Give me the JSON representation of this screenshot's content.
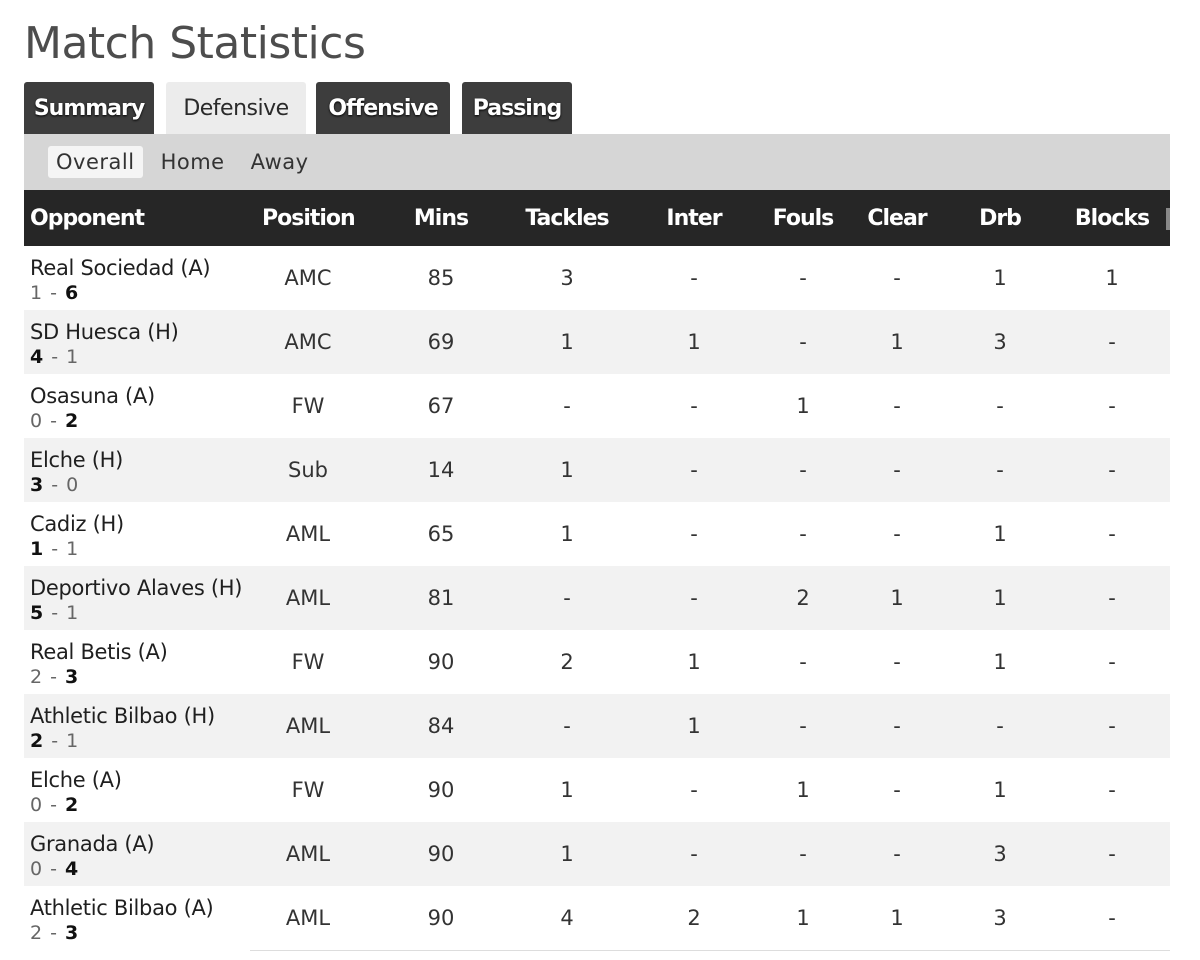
{
  "page": {
    "title": "Match Statistics"
  },
  "tabs": [
    {
      "label": "Summary",
      "active": false
    },
    {
      "label": "Defensive",
      "active": true
    },
    {
      "label": "Offensive",
      "active": false
    },
    {
      "label": "Passing",
      "active": false
    }
  ],
  "subtabs": [
    {
      "label": "Overall",
      "active": true
    },
    {
      "label": "Home",
      "active": false
    },
    {
      "label": "Away",
      "active": false
    }
  ],
  "table": {
    "headers": [
      "Opponent",
      "Position",
      "Mins",
      "Tackles",
      "Inter",
      "Fouls",
      "Clear",
      "Drb",
      "Blocks"
    ],
    "rows": [
      {
        "opponent": "Real Sociedad (A)",
        "score_home": "1",
        "score_away": "6",
        "bold": "away",
        "position": "AMC",
        "mins": "85",
        "tackles": "3",
        "inter": "-",
        "fouls": "-",
        "clear": "-",
        "drb": "1",
        "blocks": "1"
      },
      {
        "opponent": "SD Huesca (H)",
        "score_home": "4",
        "score_away": "1",
        "bold": "home",
        "position": "AMC",
        "mins": "69",
        "tackles": "1",
        "inter": "1",
        "fouls": "-",
        "clear": "1",
        "drb": "3",
        "blocks": "-"
      },
      {
        "opponent": "Osasuna (A)",
        "score_home": "0",
        "score_away": "2",
        "bold": "away",
        "position": "FW",
        "mins": "67",
        "tackles": "-",
        "inter": "-",
        "fouls": "1",
        "clear": "-",
        "drb": "-",
        "blocks": "-"
      },
      {
        "opponent": "Elche (H)",
        "score_home": "3",
        "score_away": "0",
        "bold": "home",
        "position": "Sub",
        "mins": "14",
        "tackles": "1",
        "inter": "-",
        "fouls": "-",
        "clear": "-",
        "drb": "-",
        "blocks": "-"
      },
      {
        "opponent": "Cadiz (H)",
        "score_home": "1",
        "score_away": "1",
        "bold": "home",
        "position": "AML",
        "mins": "65",
        "tackles": "1",
        "inter": "-",
        "fouls": "-",
        "clear": "-",
        "drb": "1",
        "blocks": "-"
      },
      {
        "opponent": "Deportivo Alaves (H)",
        "score_home": "5",
        "score_away": "1",
        "bold": "home",
        "position": "AML",
        "mins": "81",
        "tackles": "-",
        "inter": "-",
        "fouls": "2",
        "clear": "1",
        "drb": "1",
        "blocks": "-"
      },
      {
        "opponent": "Real Betis (A)",
        "score_home": "2",
        "score_away": "3",
        "bold": "away",
        "position": "FW",
        "mins": "90",
        "tackles": "2",
        "inter": "1",
        "fouls": "-",
        "clear": "-",
        "drb": "1",
        "blocks": "-"
      },
      {
        "opponent": "Athletic Bilbao (H)",
        "score_home": "2",
        "score_away": "1",
        "bold": "home",
        "position": "AML",
        "mins": "84",
        "tackles": "-",
        "inter": "1",
        "fouls": "-",
        "clear": "-",
        "drb": "-",
        "blocks": "-"
      },
      {
        "opponent": "Elche (A)",
        "score_home": "0",
        "score_away": "2",
        "bold": "away",
        "position": "FW",
        "mins": "90",
        "tackles": "1",
        "inter": "-",
        "fouls": "1",
        "clear": "-",
        "drb": "1",
        "blocks": "-"
      },
      {
        "opponent": "Granada (A)",
        "score_home": "0",
        "score_away": "4",
        "bold": "away",
        "position": "AML",
        "mins": "90",
        "tackles": "1",
        "inter": "-",
        "fouls": "-",
        "clear": "-",
        "drb": "3",
        "blocks": "-"
      },
      {
        "opponent": "Athletic Bilbao (A)",
        "score_home": "2",
        "score_away": "3",
        "bold": "away",
        "position": "AML",
        "mins": "90",
        "tackles": "4",
        "inter": "2",
        "fouls": "1",
        "clear": "1",
        "drb": "3",
        "blocks": "-"
      }
    ]
  }
}
